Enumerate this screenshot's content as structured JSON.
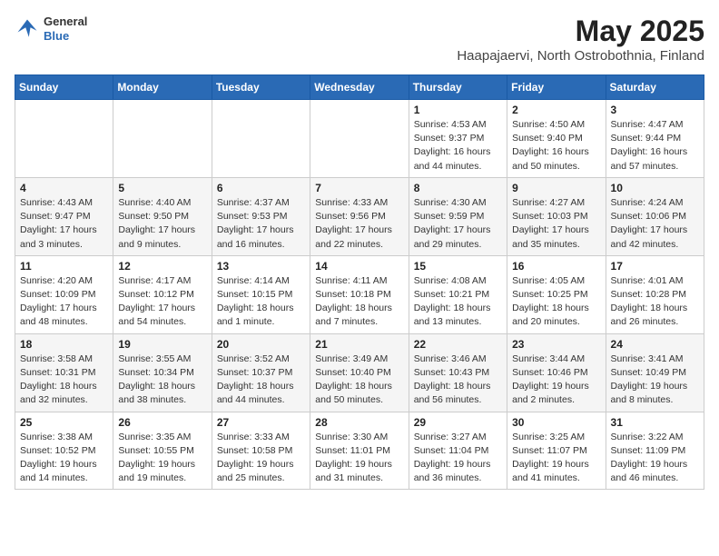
{
  "header": {
    "logo": {
      "general": "General",
      "blue": "Blue"
    },
    "title": "May 2025",
    "subtitle": "Haapajaervi, North Ostrobothnia, Finland"
  },
  "weekdays": [
    "Sunday",
    "Monday",
    "Tuesday",
    "Wednesday",
    "Thursday",
    "Friday",
    "Saturday"
  ],
  "weeks": [
    [
      {
        "day": "",
        "info": ""
      },
      {
        "day": "",
        "info": ""
      },
      {
        "day": "",
        "info": ""
      },
      {
        "day": "",
        "info": ""
      },
      {
        "day": "1",
        "info": "Sunrise: 4:53 AM\nSunset: 9:37 PM\nDaylight: 16 hours\nand 44 minutes."
      },
      {
        "day": "2",
        "info": "Sunrise: 4:50 AM\nSunset: 9:40 PM\nDaylight: 16 hours\nand 50 minutes."
      },
      {
        "day": "3",
        "info": "Sunrise: 4:47 AM\nSunset: 9:44 PM\nDaylight: 16 hours\nand 57 minutes."
      }
    ],
    [
      {
        "day": "4",
        "info": "Sunrise: 4:43 AM\nSunset: 9:47 PM\nDaylight: 17 hours\nand 3 minutes."
      },
      {
        "day": "5",
        "info": "Sunrise: 4:40 AM\nSunset: 9:50 PM\nDaylight: 17 hours\nand 9 minutes."
      },
      {
        "day": "6",
        "info": "Sunrise: 4:37 AM\nSunset: 9:53 PM\nDaylight: 17 hours\nand 16 minutes."
      },
      {
        "day": "7",
        "info": "Sunrise: 4:33 AM\nSunset: 9:56 PM\nDaylight: 17 hours\nand 22 minutes."
      },
      {
        "day": "8",
        "info": "Sunrise: 4:30 AM\nSunset: 9:59 PM\nDaylight: 17 hours\nand 29 minutes."
      },
      {
        "day": "9",
        "info": "Sunrise: 4:27 AM\nSunset: 10:03 PM\nDaylight: 17 hours\nand 35 minutes."
      },
      {
        "day": "10",
        "info": "Sunrise: 4:24 AM\nSunset: 10:06 PM\nDaylight: 17 hours\nand 42 minutes."
      }
    ],
    [
      {
        "day": "11",
        "info": "Sunrise: 4:20 AM\nSunset: 10:09 PM\nDaylight: 17 hours\nand 48 minutes."
      },
      {
        "day": "12",
        "info": "Sunrise: 4:17 AM\nSunset: 10:12 PM\nDaylight: 17 hours\nand 54 minutes."
      },
      {
        "day": "13",
        "info": "Sunrise: 4:14 AM\nSunset: 10:15 PM\nDaylight: 18 hours\nand 1 minute."
      },
      {
        "day": "14",
        "info": "Sunrise: 4:11 AM\nSunset: 10:18 PM\nDaylight: 18 hours\nand 7 minutes."
      },
      {
        "day": "15",
        "info": "Sunrise: 4:08 AM\nSunset: 10:21 PM\nDaylight: 18 hours\nand 13 minutes."
      },
      {
        "day": "16",
        "info": "Sunrise: 4:05 AM\nSunset: 10:25 PM\nDaylight: 18 hours\nand 20 minutes."
      },
      {
        "day": "17",
        "info": "Sunrise: 4:01 AM\nSunset: 10:28 PM\nDaylight: 18 hours\nand 26 minutes."
      }
    ],
    [
      {
        "day": "18",
        "info": "Sunrise: 3:58 AM\nSunset: 10:31 PM\nDaylight: 18 hours\nand 32 minutes."
      },
      {
        "day": "19",
        "info": "Sunrise: 3:55 AM\nSunset: 10:34 PM\nDaylight: 18 hours\nand 38 minutes."
      },
      {
        "day": "20",
        "info": "Sunrise: 3:52 AM\nSunset: 10:37 PM\nDaylight: 18 hours\nand 44 minutes."
      },
      {
        "day": "21",
        "info": "Sunrise: 3:49 AM\nSunset: 10:40 PM\nDaylight: 18 hours\nand 50 minutes."
      },
      {
        "day": "22",
        "info": "Sunrise: 3:46 AM\nSunset: 10:43 PM\nDaylight: 18 hours\nand 56 minutes."
      },
      {
        "day": "23",
        "info": "Sunrise: 3:44 AM\nSunset: 10:46 PM\nDaylight: 19 hours\nand 2 minutes."
      },
      {
        "day": "24",
        "info": "Sunrise: 3:41 AM\nSunset: 10:49 PM\nDaylight: 19 hours\nand 8 minutes."
      }
    ],
    [
      {
        "day": "25",
        "info": "Sunrise: 3:38 AM\nSunset: 10:52 PM\nDaylight: 19 hours\nand 14 minutes."
      },
      {
        "day": "26",
        "info": "Sunrise: 3:35 AM\nSunset: 10:55 PM\nDaylight: 19 hours\nand 19 minutes."
      },
      {
        "day": "27",
        "info": "Sunrise: 3:33 AM\nSunset: 10:58 PM\nDaylight: 19 hours\nand 25 minutes."
      },
      {
        "day": "28",
        "info": "Sunrise: 3:30 AM\nSunset: 11:01 PM\nDaylight: 19 hours\nand 31 minutes."
      },
      {
        "day": "29",
        "info": "Sunrise: 3:27 AM\nSunset: 11:04 PM\nDaylight: 19 hours\nand 36 minutes."
      },
      {
        "day": "30",
        "info": "Sunrise: 3:25 AM\nSunset: 11:07 PM\nDaylight: 19 hours\nand 41 minutes."
      },
      {
        "day": "31",
        "info": "Sunrise: 3:22 AM\nSunset: 11:09 PM\nDaylight: 19 hours\nand 46 minutes."
      }
    ]
  ]
}
